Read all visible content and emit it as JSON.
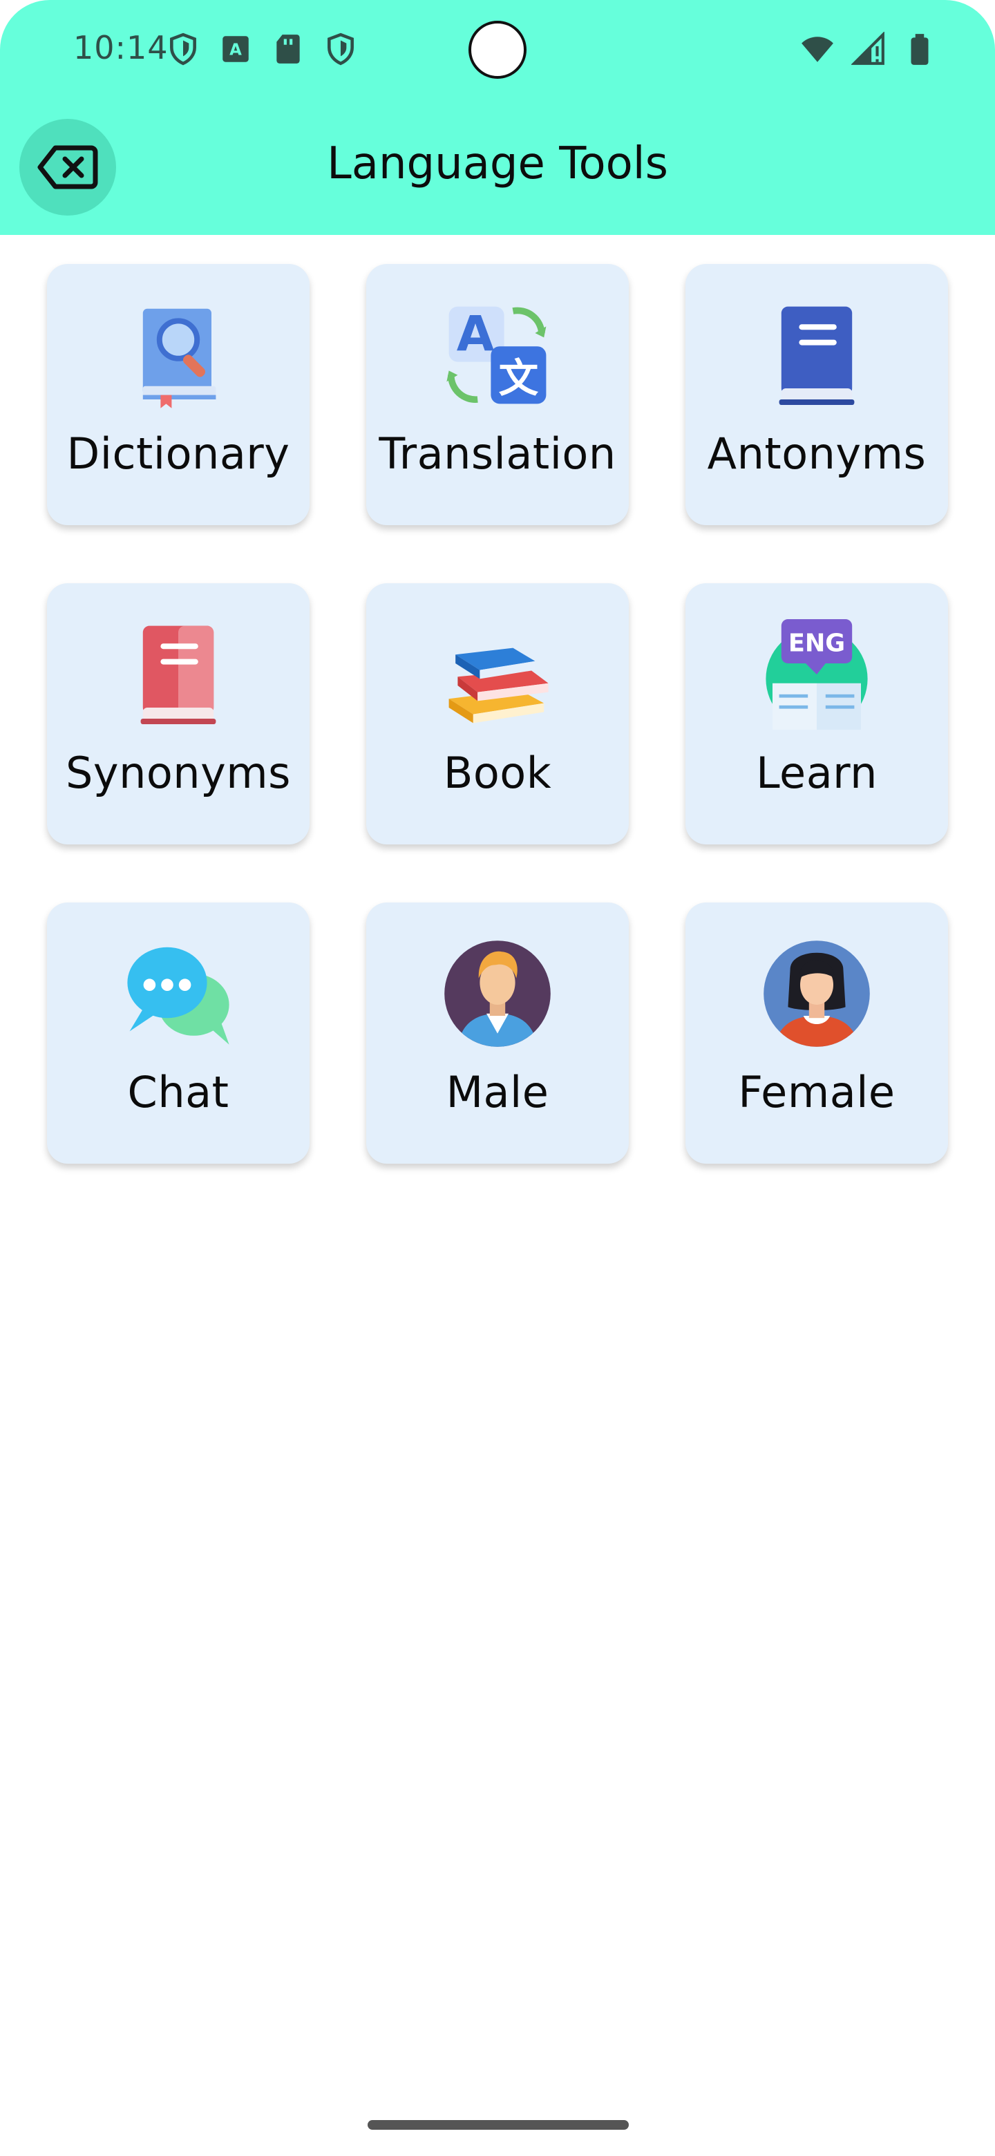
{
  "status_bar": {
    "time": "10:14",
    "left_icons": [
      "shield-icon",
      "text-a-icon",
      "sd-card-icon",
      "shield-icon"
    ],
    "right_icons": [
      "wifi-icon",
      "signal-icon",
      "battery-icon"
    ]
  },
  "header": {
    "title": "Language Tools",
    "back_icon": "backspace-icon",
    "background": "#66FFDB"
  },
  "tools": [
    {
      "label": "Dictionary",
      "icon": "dictionary-book-icon"
    },
    {
      "label": "Translation",
      "icon": "translate-icon"
    },
    {
      "label": "Antonyms",
      "icon": "blue-book-icon"
    },
    {
      "label": "Synonyms",
      "icon": "red-book-icon"
    },
    {
      "label": "Book",
      "icon": "book-stack-icon"
    },
    {
      "label": "Learn",
      "icon": "eng-learn-icon"
    },
    {
      "label": "Chat",
      "icon": "chat-bubbles-icon"
    },
    {
      "label": "Male",
      "icon": "male-avatar-icon"
    },
    {
      "label": "Female",
      "icon": "female-avatar-icon"
    }
  ],
  "colors": {
    "card_background": "#E3EFFB",
    "accent": "#66FFDB"
  }
}
